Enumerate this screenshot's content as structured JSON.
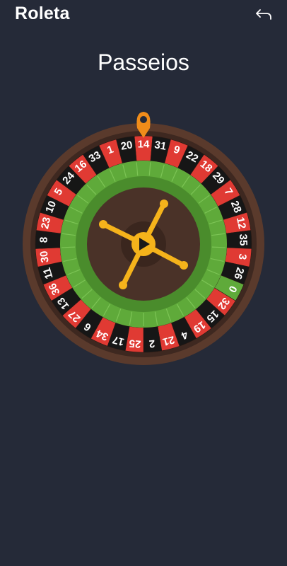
{
  "header": {
    "title": "Roleta",
    "back_icon": "back-arrow-icon"
  },
  "main": {
    "subtitle": "Passeios"
  },
  "wheel": {
    "numbers": [
      {
        "n": "14",
        "c": "#e03a33"
      },
      {
        "n": "31",
        "c": "#161616"
      },
      {
        "n": "9",
        "c": "#e03a33"
      },
      {
        "n": "22",
        "c": "#161616"
      },
      {
        "n": "18",
        "c": "#e03a33"
      },
      {
        "n": "29",
        "c": "#161616"
      },
      {
        "n": "7",
        "c": "#e03a33"
      },
      {
        "n": "28",
        "c": "#161616"
      },
      {
        "n": "12",
        "c": "#e03a33"
      },
      {
        "n": "35",
        "c": "#161616"
      },
      {
        "n": "3",
        "c": "#e03a33"
      },
      {
        "n": "26",
        "c": "#161616"
      },
      {
        "n": "0",
        "c": "#5faa3a"
      },
      {
        "n": "32",
        "c": "#e03a33"
      },
      {
        "n": "15",
        "c": "#161616"
      },
      {
        "n": "19",
        "c": "#e03a33"
      },
      {
        "n": "4",
        "c": "#161616"
      },
      {
        "n": "21",
        "c": "#e03a33"
      },
      {
        "n": "2",
        "c": "#161616"
      },
      {
        "n": "25",
        "c": "#e03a33"
      },
      {
        "n": "17",
        "c": "#161616"
      },
      {
        "n": "34",
        "c": "#e03a33"
      },
      {
        "n": "6",
        "c": "#161616"
      },
      {
        "n": "27",
        "c": "#e03a33"
      },
      {
        "n": "13",
        "c": "#161616"
      },
      {
        "n": "36",
        "c": "#e03a33"
      },
      {
        "n": "11",
        "c": "#161616"
      },
      {
        "n": "30",
        "c": "#e03a33"
      },
      {
        "n": "8",
        "c": "#161616"
      },
      {
        "n": "23",
        "c": "#e03a33"
      },
      {
        "n": "10",
        "c": "#161616"
      },
      {
        "n": "5",
        "c": "#e03a33"
      },
      {
        "n": "24",
        "c": "#161616"
      },
      {
        "n": "16",
        "c": "#e03a33"
      },
      {
        "n": "33",
        "c": "#161616"
      },
      {
        "n": "1",
        "c": "#e03a33"
      },
      {
        "n": "20",
        "c": "#161616"
      }
    ],
    "colors": {
      "rim": "#5a3a2c",
      "rim_inner": "#3e2820",
      "green_outer": "#5faa3a",
      "green_inner": "#4a8c2c",
      "center": "#4a3228",
      "spokes": "#f5b31b",
      "pointer": "#f08c1a",
      "hub": "#f5b31b"
    },
    "pointer_icon": "map-pin-icon",
    "play_icon": "play-icon"
  }
}
